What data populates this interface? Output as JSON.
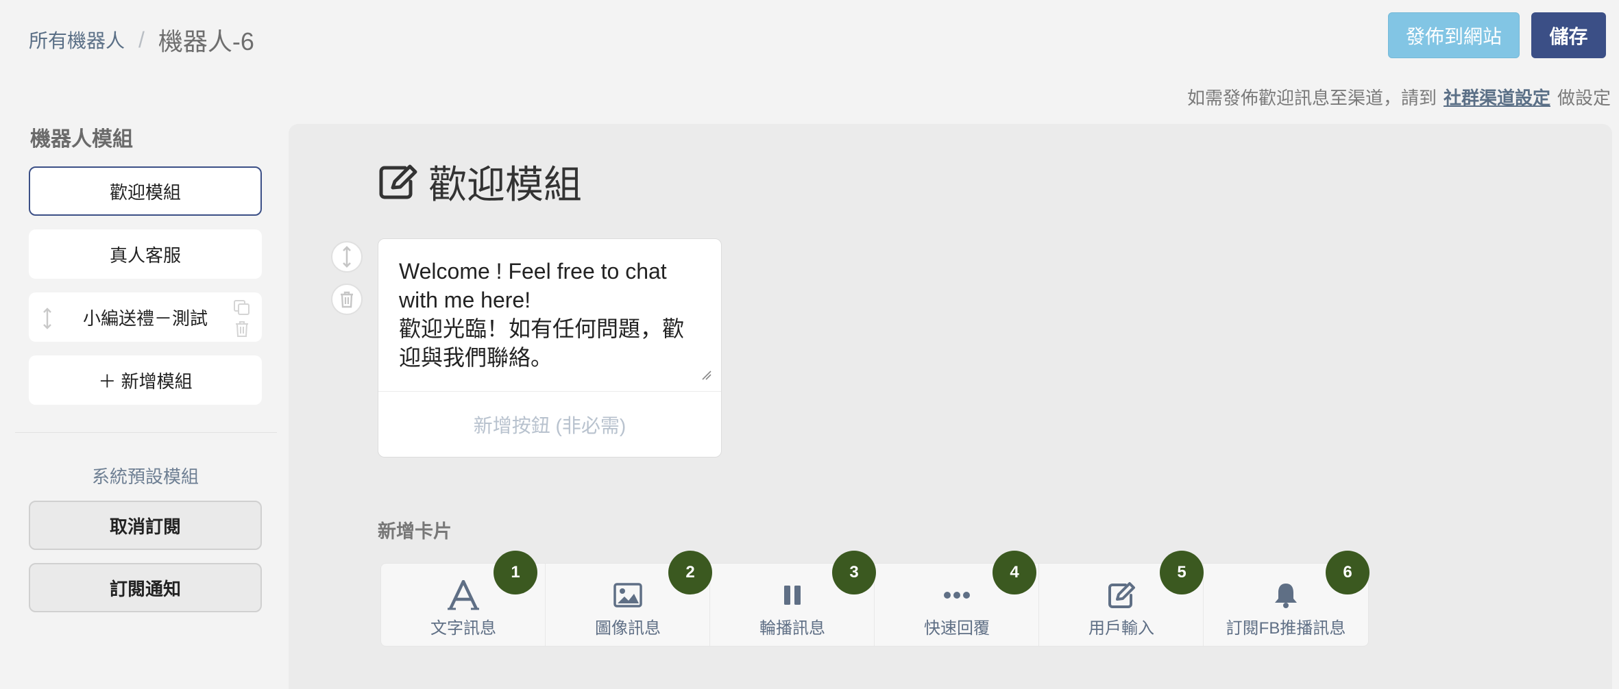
{
  "breadcrumb": {
    "parent": "所有機器人",
    "separator": "/",
    "current": "機器人-6"
  },
  "header": {
    "publish_label": "發佈到網站",
    "save_label": "儲存"
  },
  "notice": {
    "prefix": "如需發佈歡迎訊息至渠道，請到",
    "link": "社群渠道設定",
    "suffix": "做設定"
  },
  "sidebar": {
    "title": "機器人模組",
    "modules": [
      {
        "label": "歡迎模組",
        "active": true
      },
      {
        "label": "真人客服"
      },
      {
        "label": "小編送禮－測試"
      },
      {
        "label": "＋ 新增模組"
      }
    ],
    "system_title": "系統預設模組",
    "system_modules": [
      {
        "label": "取消訂閱"
      },
      {
        "label": "訂閱通知"
      }
    ]
  },
  "main": {
    "title": "歡迎模組",
    "title_icon": "edit-icon",
    "text_card": {
      "message": "Welcome ! Feel free to chat\nwith me here!\n歡迎光臨！如有任何問題，歡\n迎與我們聯絡。",
      "add_button_label": "新增按鈕 (非必需)"
    },
    "add_card_label": "新增卡片",
    "card_types": [
      {
        "label": "文字訊息",
        "icon": "text-icon",
        "badge": "1"
      },
      {
        "label": "圖像訊息",
        "icon": "image-icon",
        "badge": "2"
      },
      {
        "label": "輪播訊息",
        "icon": "carousel-icon",
        "badge": "3"
      },
      {
        "label": "快速回覆",
        "icon": "quick-reply-icon",
        "badge": "4"
      },
      {
        "label": "用戶輸入",
        "icon": "user-input-icon",
        "badge": "5"
      },
      {
        "label": "訂閱FB推播訊息",
        "icon": "bell-icon",
        "badge": "6"
      }
    ]
  },
  "colors": {
    "primary": "#3b4f86",
    "publish": "#82c5e4",
    "badge": "#3b5920",
    "link": "#5a6f86"
  }
}
